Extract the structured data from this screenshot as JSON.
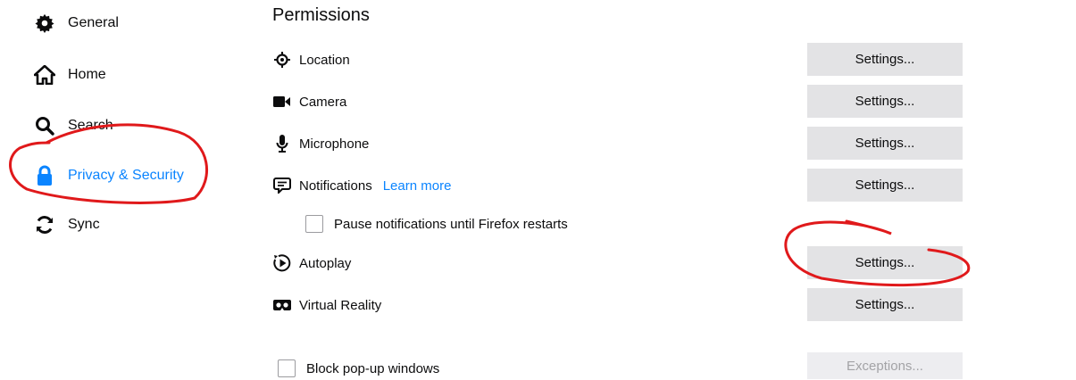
{
  "sidebar": {
    "items": [
      {
        "label": "General",
        "icon": "gear-icon"
      },
      {
        "label": "Home",
        "icon": "home-icon"
      },
      {
        "label": "Search",
        "icon": "search-icon"
      },
      {
        "label": "Privacy & Security",
        "icon": "lock-icon",
        "selected": true
      },
      {
        "label": "Sync",
        "icon": "sync-icon"
      }
    ]
  },
  "permissions": {
    "title": "Permissions",
    "rows": [
      {
        "label": "Location",
        "icon": "location-icon",
        "button": "Settings..."
      },
      {
        "label": "Camera",
        "icon": "camera-icon",
        "button": "Settings..."
      },
      {
        "label": "Microphone",
        "icon": "microphone-icon",
        "button": "Settings..."
      },
      {
        "label": "Notifications",
        "icon": "notifications-icon",
        "link": "Learn more",
        "button": "Settings..."
      },
      {
        "label": "Autoplay",
        "icon": "autoplay-icon",
        "button": "Settings..."
      },
      {
        "label": "Virtual Reality",
        "icon": "vr-icon",
        "button": "Settings..."
      }
    ],
    "pause_notifications_label": "Pause notifications until Firefox restarts",
    "block_popups_label": "Block pop-up windows",
    "exceptions_label": "Exceptions..."
  },
  "colors": {
    "accent": "#0a84ff",
    "button_bg": "#e3e3e5",
    "annotation": "#e0191b"
  }
}
